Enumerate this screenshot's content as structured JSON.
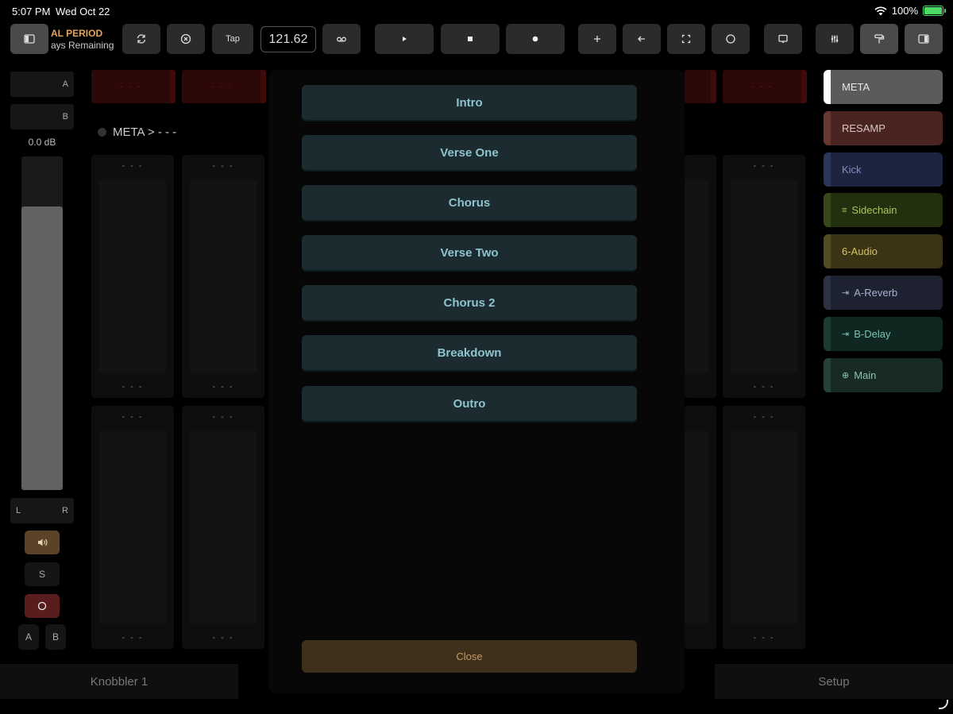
{
  "status": {
    "time": "5:07 PM",
    "date": "Wed Oct 22",
    "battery": "100%",
    "battery_level": 1.0
  },
  "toolbar": {
    "trial_line1": "AL PERIOD",
    "trial_line2": "ays Remaining",
    "tap_label": "Tap",
    "tempo": "121.62"
  },
  "left": {
    "send_a": "A",
    "send_b": "B",
    "volume": "0.0 dB",
    "volume_level": 0.85,
    "pan_l": "L",
    "pan_r": "R",
    "solo": "S",
    "ab_a": "A",
    "ab_b": "B"
  },
  "device": {
    "meta_path": "META > - - -",
    "empty": "- - -"
  },
  "sections": [
    "Intro",
    "Verse One",
    "Chorus",
    "Verse Two",
    "Chorus 2",
    "Breakdown",
    "Outro"
  ],
  "close_label": "Close",
  "tracks": [
    {
      "name": "META",
      "icon": "",
      "bg": "#5b5b5b",
      "bar": "#ffffff",
      "fg": "#e6e6e6"
    },
    {
      "name": "RESAMP",
      "icon": "",
      "bg": "#4a2420",
      "bar": "#6a3630",
      "fg": "#d8c5c2"
    },
    {
      "name": "Kick",
      "icon": "",
      "bg": "#1c2440",
      "bar": "#2a365c",
      "fg": "#7f8fc4"
    },
    {
      "name": "Sidechain",
      "icon": "≡",
      "bg": "#22300f",
      "bar": "#34481a",
      "fg": "#a7c85a"
    },
    {
      "name": "6-Audio",
      "icon": "",
      "bg": "#3a3414",
      "bar": "#544b1e",
      "fg": "#d6c260"
    },
    {
      "name": "A-Reverb",
      "icon": "⇥",
      "bg": "#1e2230",
      "bar": "#2c3244",
      "fg": "#a4b2cf"
    },
    {
      "name": "B-Delay",
      "icon": "⇥",
      "bg": "#102620",
      "bar": "#1b3a32",
      "fg": "#78c3b1"
    },
    {
      "name": "Main",
      "icon": "⊕",
      "bg": "#172a24",
      "bar": "#244238",
      "fg": "#8dc2b0"
    }
  ],
  "bottom": {
    "left_label": "Knobbler 1",
    "right_label": "Setup"
  }
}
